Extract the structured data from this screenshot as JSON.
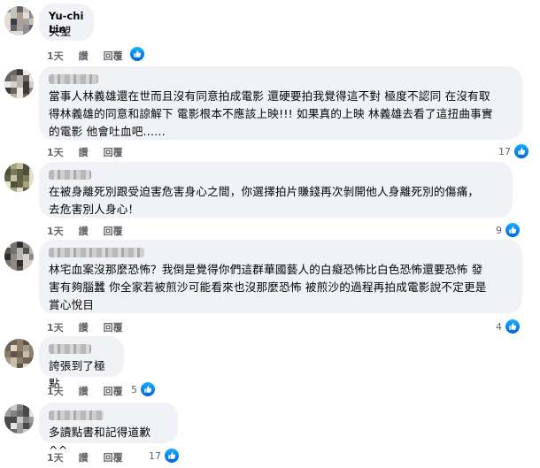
{
  "comments": [
    {
      "author": "Yu-chi Lin",
      "text": "失望",
      "time": "1天",
      "like_label": "讚",
      "reply_label": "回覆",
      "reactions": ""
    },
    {
      "author": "",
      "text": "當事人林義雄還在世而且沒有同意拍成電影 還硬要拍我覺得這不對 極度不認同 在沒有取\n得林義雄的同意和諒解下 電影根本不應該上映!!! 如果真的上映 林義雄去看了這扭曲事實\n的電影 他會吐血吧......",
      "time": "1天",
      "like_label": "讚",
      "reply_label": "回覆",
      "reactions": "17"
    },
    {
      "author": "",
      "text": "在被身離死別跟受迫害危害身心之間，你選擇拍片賺錢再次剝開他人身離死別的傷痛，\n去危害別人身心！",
      "time": "1天",
      "like_label": "讚",
      "reply_label": "回覆",
      "reactions": "9"
    },
    {
      "author": "",
      "text": "林宅血案沒那麼恐怖？我倒是覺得你們這群華國藝人的白癡恐怖比白色恐怖還要恐怖 發\n害有夠腦蠶 你全家若被煎沙可能看來也沒那麼恐怖 被煎沙的過程再拍成電影說不定更是\n賞心悅目",
      "time": "1天",
      "like_label": "讚",
      "reply_label": "回覆",
      "reactions": "4"
    },
    {
      "author": "",
      "text": "誇張到了極點",
      "time": "1天",
      "like_label": "讚",
      "reply_label": "回覆",
      "reactions": "5"
    },
    {
      "author": "",
      "text": "多讀點書和記得道歉^^",
      "time": "1天",
      "like_label": "讚",
      "reply_label": "回覆",
      "reactions": "17"
    }
  ],
  "colors": {
    "bubble": "#f0f2f5",
    "meta_text": "#65676b",
    "like_blue": "#1877f2"
  },
  "icons": {
    "like": "thumbs-up-icon"
  }
}
